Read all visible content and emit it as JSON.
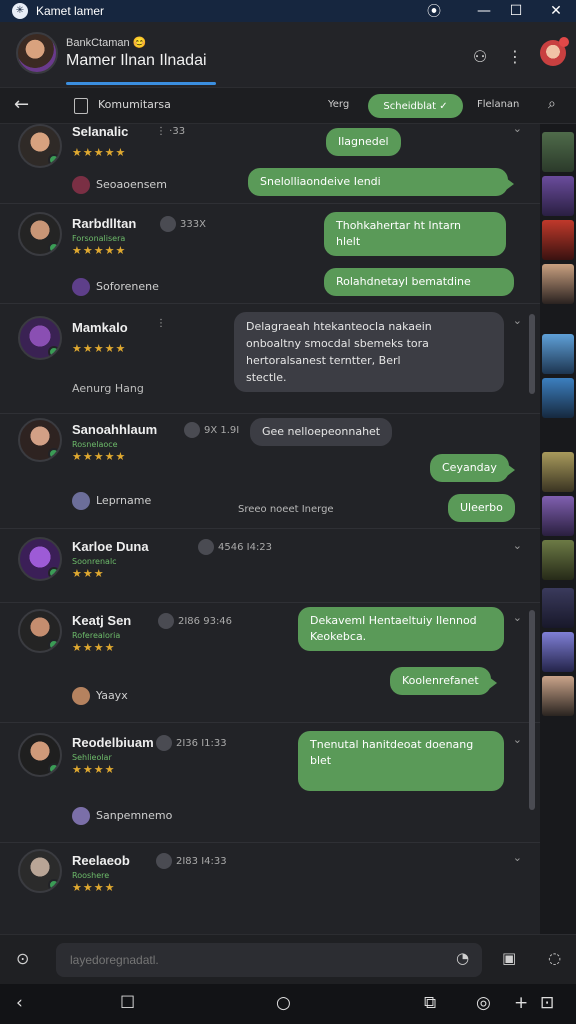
{
  "window": {
    "title": "Kamet lamer",
    "controls": [
      "record-icon",
      "minimize-icon",
      "maximize-icon",
      "close-icon"
    ]
  },
  "header": {
    "subtitle": "BankCtaman 😊",
    "title": "Mamer Ilnan Ilnadai",
    "icons": [
      "share-icon",
      "more-icon"
    ]
  },
  "toolbar": {
    "label": "Komumitarsa",
    "tab1": "Yerg",
    "active_pill": "Scheidblat ✓",
    "tab3": "Flelanan"
  },
  "threads": [
    {
      "name": "Selanalic",
      "subtitle": "",
      "stars": "★★★★★",
      "meta": "⋮  ·33",
      "reply": "Seoaoensem",
      "bubbles": [
        "Ilagnedel",
        "Snelolliaondeive                            Iendi"
      ]
    },
    {
      "name": "Rarbdlltan",
      "subtitle": "Forsonalisera",
      "stars": "★★★★★",
      "meta": "333X",
      "reply": "Soforenene",
      "bubbles": [
        "Thohkahertar ht Intarn\nhlelt",
        "Rolahdnetayl bematdine"
      ]
    },
    {
      "name": "Mamkalo",
      "subtitle": "",
      "stars": "★★★★★",
      "meta": "⋮",
      "reply": "Aenurg Hang",
      "bubbles": [
        "Delagraeah htekanteocla nakaein\nonboaltny smocdal sbemeks tora\nhertoralsanest terntter, Berl\nstectle."
      ]
    },
    {
      "name": "Sanoahhlaum",
      "subtitle": "Rosnelaoce",
      "stars": "★★★★★",
      "meta": "9X 1.9I",
      "reply": "Leprname",
      "hint": "Sreeo noeet Inerge",
      "bubbles": [
        "Gee nelloepeonnahet",
        "Ceyanday",
        "Uleerbo"
      ]
    },
    {
      "name": "Karloe Duna",
      "subtitle": "Soonrenalc",
      "stars": "★★★",
      "meta": "4546   I4:23",
      "reply": "",
      "bubbles": []
    },
    {
      "name": "Keatj Sen",
      "subtitle": "Roferealoria",
      "stars": "★★★★",
      "meta": "2I86   93:46",
      "reply": "Yaayx",
      "bubbles": [
        "Dekaveml Hentaeltuiy Ilennod\nKeokebca.",
        "Koolenrefanet"
      ]
    },
    {
      "name": "Reodelbiuam",
      "subtitle": "Sehlieolar",
      "stars": "★★★★",
      "meta": "2I36   I1:33",
      "reply": "Sanpemnemo",
      "bubbles": [
        "Tnenutal hanitdeoat doenang\nblet"
      ]
    },
    {
      "name": "Reelaeob",
      "subtitle": "Rooshere",
      "stars": "★★★★",
      "meta": "2I83   I4:33",
      "reply": "",
      "bubbles": []
    }
  ],
  "composer": {
    "placeholder": "layedoregnadatl."
  },
  "colors": {
    "accent_green": "#5a9a58",
    "titlebar": "#16263f",
    "background": "#222327"
  }
}
